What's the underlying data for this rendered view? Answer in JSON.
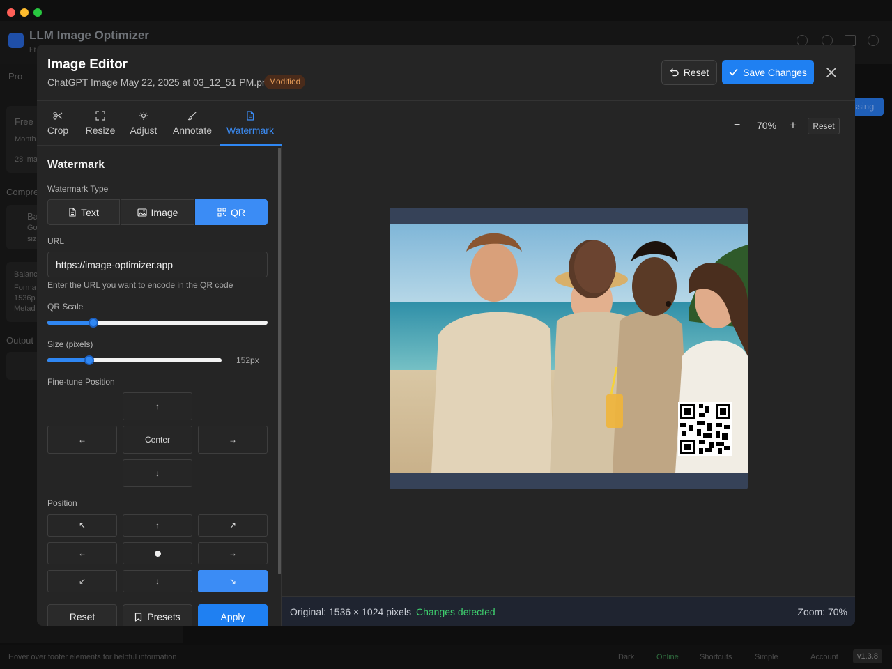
{
  "background": {
    "app_title": "LLM Image Optimizer",
    "app_subtitle": "Pr",
    "sidebar_pro": "Pro",
    "sidebar_free": "Free",
    "sidebar_month": "Month",
    "sidebar_images": "28 ima",
    "sidebar_compr": "Compre",
    "sidebar_ba": "Ba",
    "sidebar_go": "Go",
    "sidebar_siz": "siz",
    "sidebar_balanc": "Balanc",
    "sidebar_forma": "Forma",
    "sidebar_1536": "1536p",
    "sidebar_metad": "Metad",
    "sidebar_output": "Output",
    "right_pill": "ssing",
    "footer_hint": "Hover over footer elements for helpful information",
    "footer_items": [
      "Dark",
      "Online",
      "Shortcuts",
      "Simple",
      "Account"
    ],
    "version": "v1.3.8"
  },
  "modal": {
    "title": "Image Editor",
    "filename": "ChatGPT Image May 22, 2025 at 03_12_51 PM.png",
    "badge": "Modified",
    "reset_label": "Reset",
    "save_label": "Save Changes"
  },
  "tabs": [
    {
      "label": "Crop",
      "icon": "scissors-icon"
    },
    {
      "label": "Resize",
      "icon": "expand-icon"
    },
    {
      "label": "Adjust",
      "icon": "sun-icon"
    },
    {
      "label": "Annotate",
      "icon": "brush-icon"
    },
    {
      "label": "Watermark",
      "icon": "document-icon",
      "active": true
    }
  ],
  "watermark": {
    "heading": "Watermark",
    "type_label": "Watermark Type",
    "types": [
      "Text",
      "Image",
      "QR"
    ],
    "selected_type": "QR",
    "url_label": "URL",
    "url_value": "https://image-optimizer.app",
    "url_hint": "Enter the URL you want to encode in the QR code",
    "qr_scale_label": "QR Scale",
    "qr_scale_fraction": 0.21,
    "size_label": "Size (pixels)",
    "size_fraction": 0.24,
    "size_value": "152px",
    "fine_tune_label": "Fine-tune Position",
    "center_label": "Center",
    "position_label": "Position",
    "selected_position": "bottom-right",
    "reset_label": "Reset",
    "presets_label": "Presets",
    "apply_label": "Apply"
  },
  "canvas": {
    "zoom_value": "70%",
    "zoom_reset": "Reset"
  },
  "status": {
    "original": "Original: 1536 × 1024 pixels",
    "changes": "Changes detected",
    "zoom": "Zoom: 70%"
  },
  "colors": {
    "accent": "#2f87f3",
    "modified_badge": "#f0a35c",
    "changes": "#3ecf6e"
  }
}
